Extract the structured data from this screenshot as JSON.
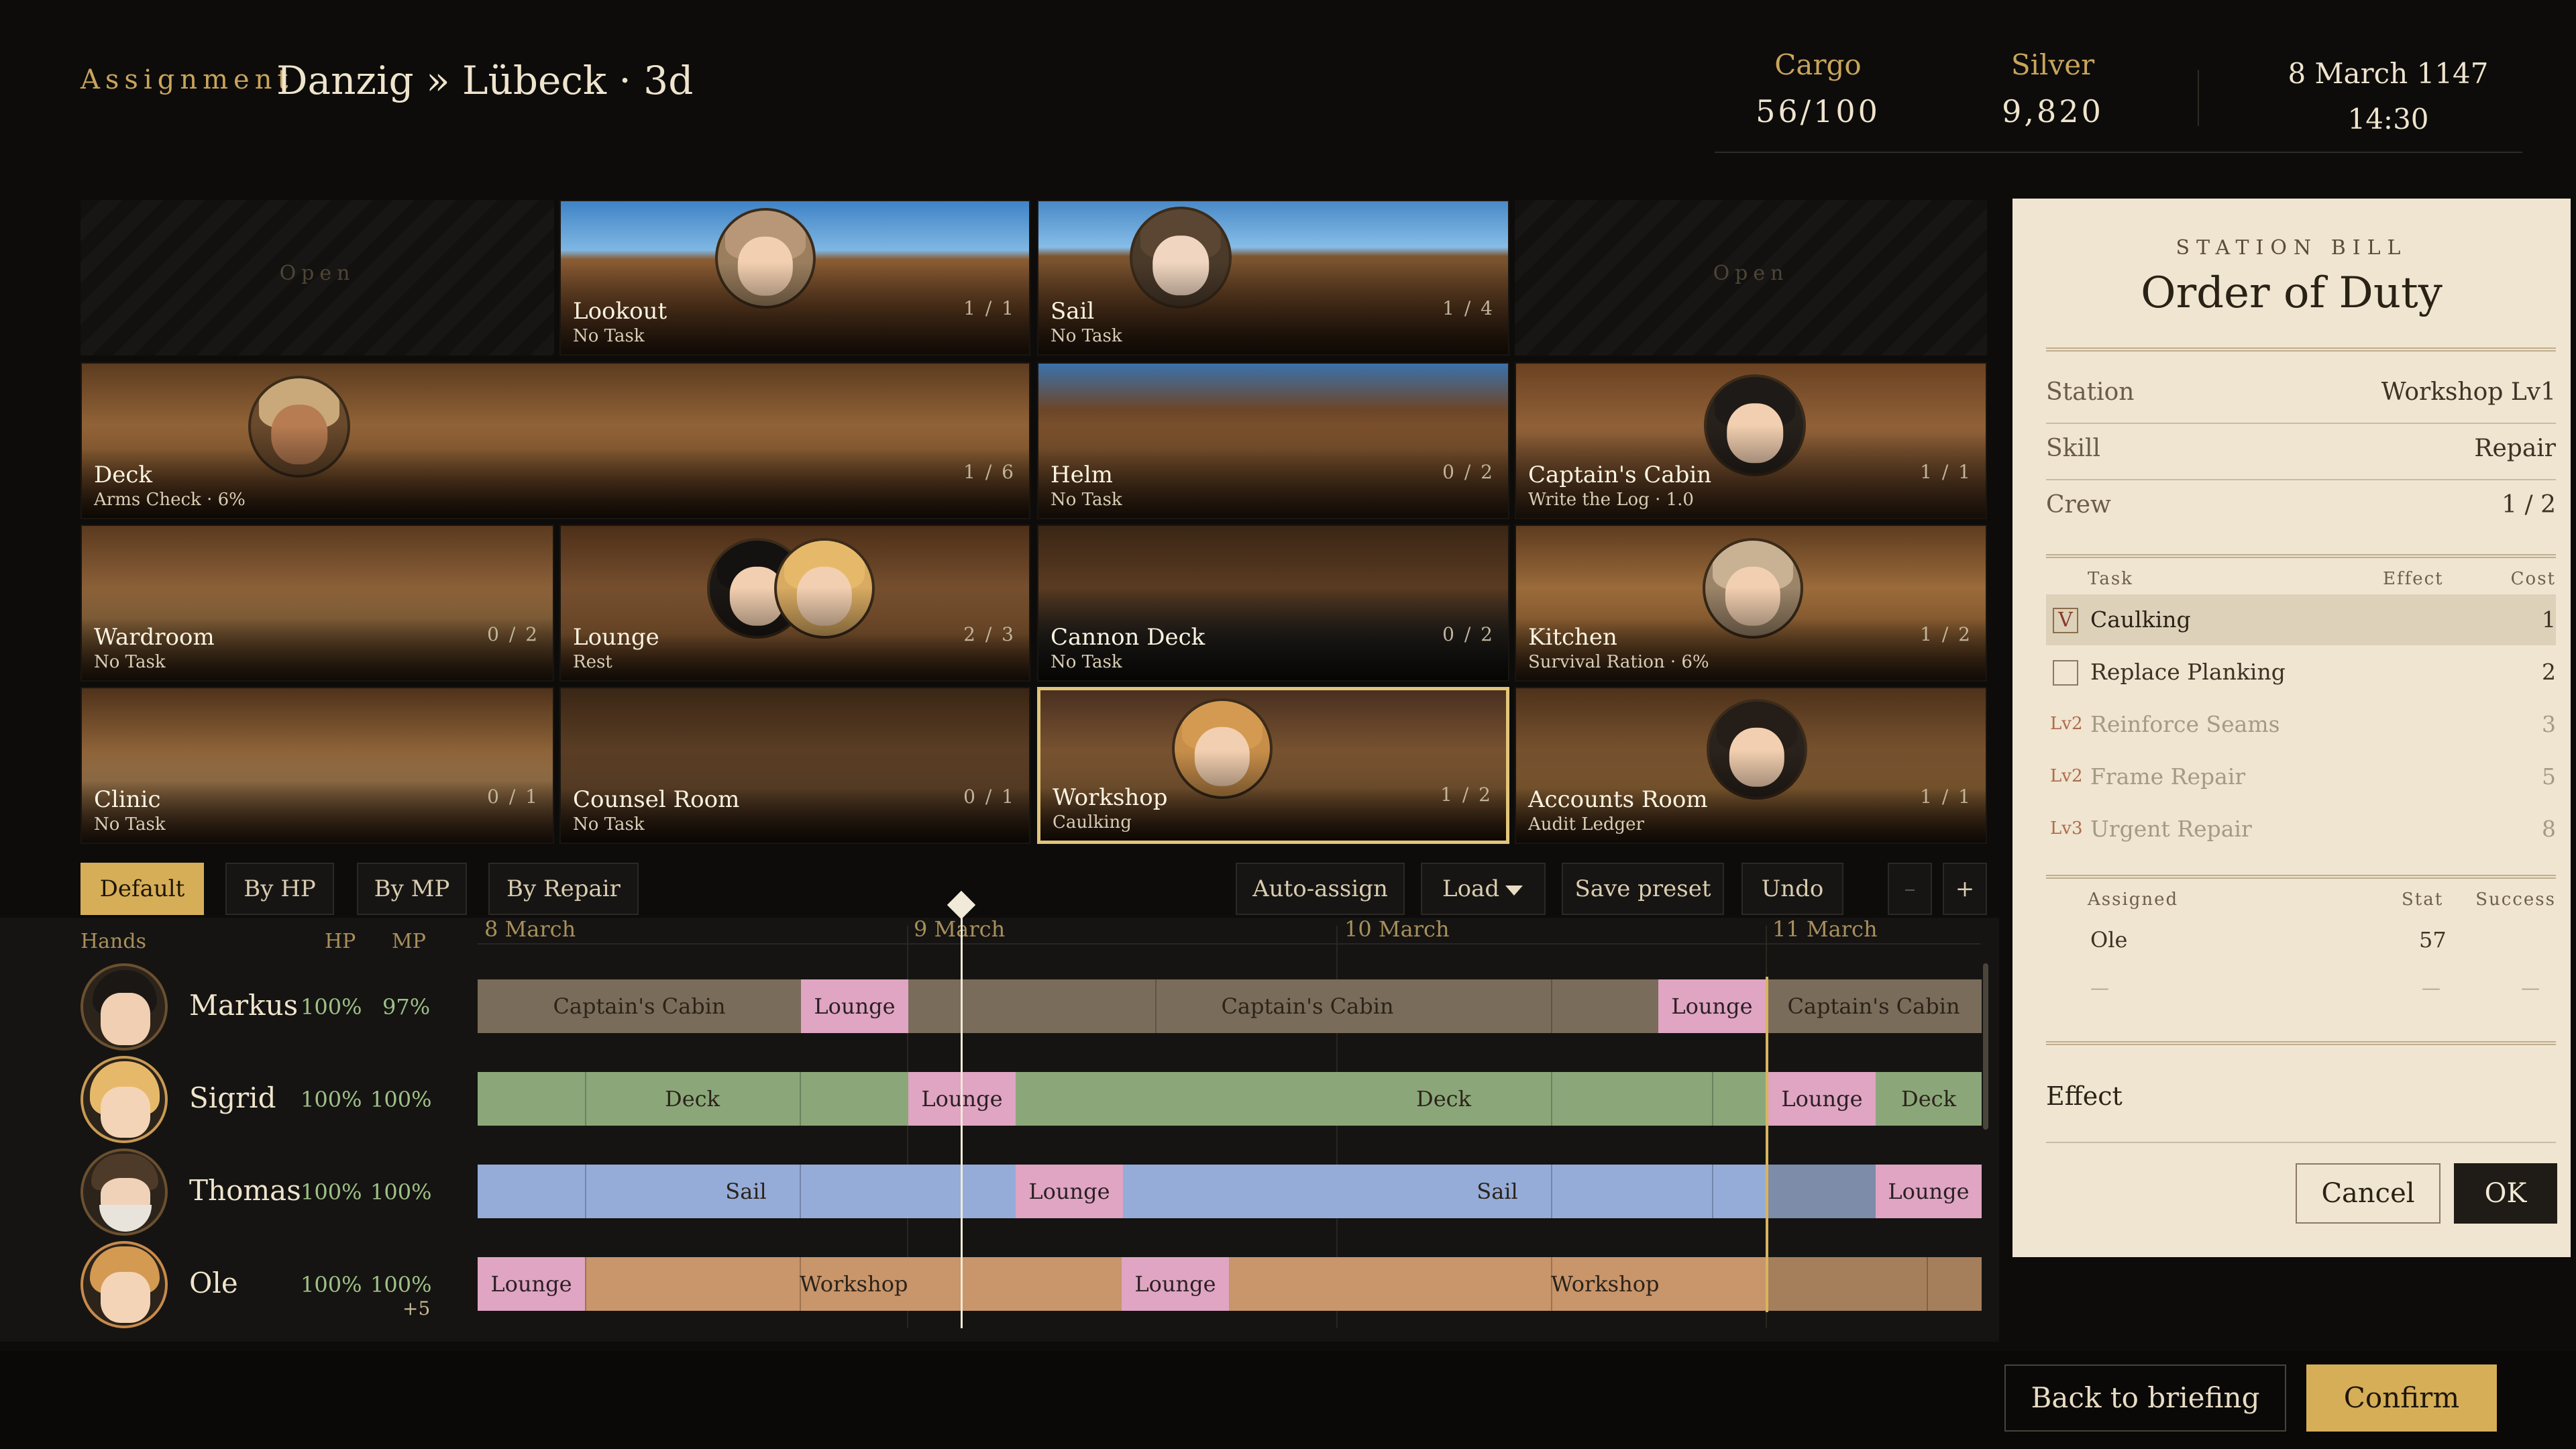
{
  "header": {
    "label": "Assignment",
    "route": "Danzig » Lübeck · 3d",
    "cargo_label": "Cargo",
    "cargo_value": "56/100",
    "silver_label": "Silver",
    "silver_value": "9,820",
    "date": "8 March 1147",
    "time": "14:30"
  },
  "rooms": {
    "open1": "Open",
    "open2": "Open",
    "lookout": {
      "name": "Lookout",
      "task": "No Task",
      "count": "1 / 1"
    },
    "sail": {
      "name": "Sail",
      "task": "No Task",
      "count": "1 / 4"
    },
    "deck": {
      "name": "Deck",
      "task": "Arms Check · 6%",
      "count": "1 / 6"
    },
    "helm": {
      "name": "Helm",
      "task": "No Task",
      "count": "0 / 2"
    },
    "captains_cabin": {
      "name": "Captain's Cabin",
      "task": "Write the Log · 1.0",
      "count": "1 / 1"
    },
    "wardroom": {
      "name": "Wardroom",
      "task": "No Task",
      "count": "0 / 2"
    },
    "lounge": {
      "name": "Lounge",
      "task": "Rest",
      "count": "2 / 3"
    },
    "cannon_deck": {
      "name": "Cannon Deck",
      "task": "No Task",
      "count": "0 / 2"
    },
    "kitchen": {
      "name": "Kitchen",
      "task": "Survival Ration · 6%",
      "count": "1 / 2"
    },
    "clinic": {
      "name": "Clinic",
      "task": "No Task",
      "count": "0 / 1"
    },
    "counsel_room": {
      "name": "Counsel Room",
      "task": "No Task",
      "count": "0 / 1"
    },
    "workshop": {
      "name": "Workshop",
      "task": "Caulking",
      "count": "1 / 2"
    },
    "accounts_room": {
      "name": "Accounts Room",
      "task": "Audit Ledger",
      "count": "1 / 1"
    }
  },
  "sort_tabs": [
    "Default",
    "By HP",
    "By MP",
    "By Repair"
  ],
  "toolbar": {
    "auto_assign": "Auto-assign",
    "load": "Load",
    "save_preset": "Save preset",
    "undo": "Undo",
    "zoom_out": "–",
    "zoom_in": "+"
  },
  "timeline": {
    "hands": "Hands",
    "hp": "HP",
    "mp": "MP",
    "days": [
      "8 March",
      "9 March",
      "10 March",
      "11 March"
    ],
    "lounge_label": "Lounge"
  },
  "crew": [
    {
      "name": "Markus",
      "hp": "100%",
      "mp": "97%"
    },
    {
      "name": "Sigrid",
      "hp": "100%",
      "mp": "100%"
    },
    {
      "name": "Thomas",
      "hp": "100%",
      "mp": "100%"
    },
    {
      "name": "Ole",
      "hp": "100%",
      "mp": "100%",
      "bonus": "+5"
    }
  ],
  "schedule": {
    "markus": [
      "Captain's Cabin",
      "Lounge",
      "Captain's Cabin",
      "Lounge",
      "Captain's Cabin"
    ],
    "sigrid": [
      "Deck",
      "Lounge",
      "Deck",
      "Lounge",
      "Deck"
    ],
    "thomas": [
      "Sail",
      "Lounge",
      "Sail",
      "Lounge"
    ],
    "ole": [
      "Lounge",
      "Workshop",
      "Lounge",
      "Workshop"
    ]
  },
  "panel": {
    "kicker": "STATION BILL",
    "title": "Order of Duty",
    "station_label": "Station",
    "station_value": "Workshop Lv1",
    "skill_label": "Skill",
    "skill_value": "Repair",
    "crew_label": "Crew",
    "crew_value": "1 / 2",
    "task_head": "Task",
    "effect_head": "Effect",
    "cost_head": "Cost",
    "tasks": [
      {
        "name": "Caulking",
        "cost": "1",
        "check": "V"
      },
      {
        "name": "Replace Planking",
        "cost": "2"
      },
      {
        "lv": "Lv2",
        "name": "Reinforce Seams",
        "cost": "3"
      },
      {
        "lv": "Lv2",
        "name": "Frame Repair",
        "cost": "5"
      },
      {
        "lv": "Lv3",
        "name": "Urgent Repair",
        "cost": "8"
      }
    ],
    "assigned_head": "Assigned",
    "stat_head": "Stat",
    "success_head": "Success",
    "assigned_name": "Ole",
    "assigned_stat": "57",
    "empty_dash": "—",
    "effect_label": "Effect",
    "cancel": "Cancel",
    "ok": "OK"
  },
  "footer": {
    "back": "Back to briefing",
    "confirm": "Confirm"
  },
  "colors": {
    "accent": "#d6ae58",
    "captains_cabin": "#7a6c5a",
    "deck": "#8ba77a",
    "sail": "#95acd9",
    "workshop": "#c9956a",
    "lounge": "#dfa5c2"
  }
}
